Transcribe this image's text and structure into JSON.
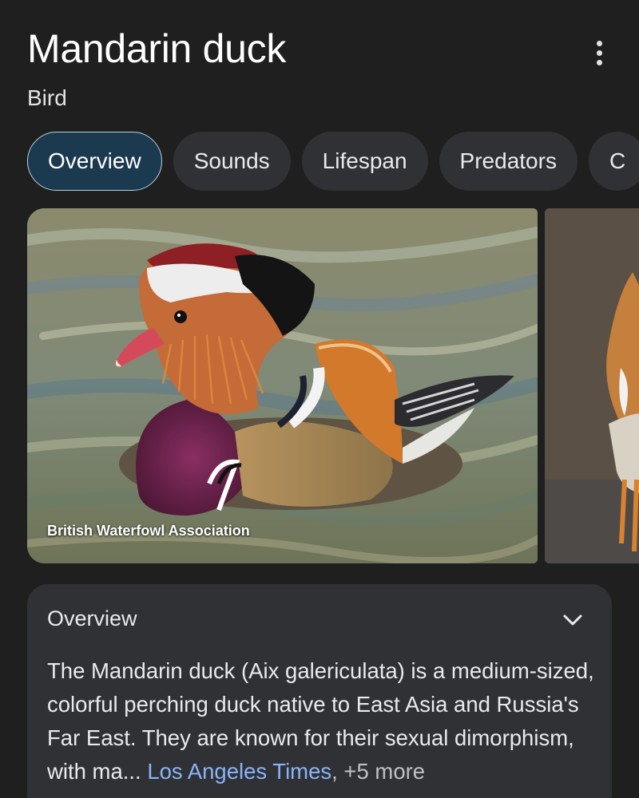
{
  "header": {
    "title": "Mandarin duck",
    "subtitle": "Bird"
  },
  "tabs": [
    {
      "label": "Overview",
      "active": true
    },
    {
      "label": "Sounds",
      "active": false
    },
    {
      "label": "Lifespan",
      "active": false
    },
    {
      "label": "Predators",
      "active": false
    },
    {
      "label": "C",
      "active": false
    }
  ],
  "images": {
    "main_credit": "British Waterfowl Association"
  },
  "overview": {
    "title": "Overview",
    "text": "The Mandarin duck (Aix galericulata) is a medium-sized, colorful perching duck native to East Asia and Russia's Far East. They are known for their sexual dimorphism, with ma",
    "ellipsis": "... ",
    "source_link": "Los Angeles Times",
    "more": ", +5 more"
  },
  "icons": {
    "more": "more-vertical-icon",
    "chevron": "chevron-down-icon"
  },
  "colors": {
    "background": "#1f1f1f",
    "card": "#303134",
    "active_tab": "#1c3a4f",
    "link": "#8ab4f8"
  }
}
